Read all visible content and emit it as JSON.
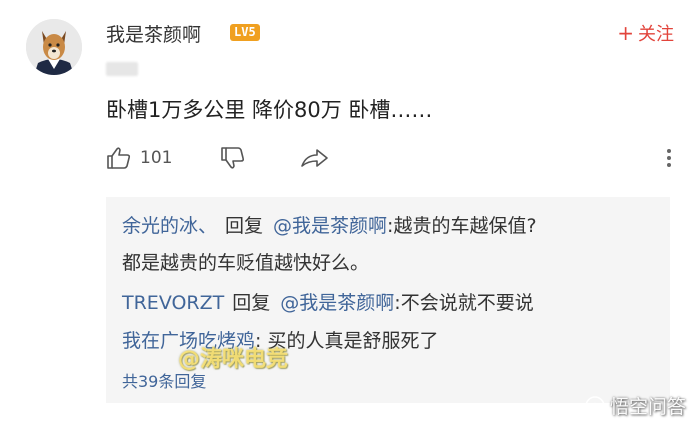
{
  "comment": {
    "username": "我是茶颜啊",
    "level": "LV5",
    "follow_label": "关注",
    "follow_prefix": "+",
    "text": "卧槽1万多公里 降价80万 卧槽……",
    "like_count": "101",
    "icons": [
      "avatar-dog",
      "thumbs-up-icon",
      "thumbs-down-icon",
      "share-icon",
      "more-vertical-icon"
    ]
  },
  "replies": {
    "items": [
      {
        "name": "余光的冰、",
        "action": "回复",
        "target": "@我是茶颜啊",
        "text": ":越贵的车越保值?",
        "continuation": "都是越贵的车贬值越快好么。"
      },
      {
        "name": "TREVORZT",
        "action": "回复",
        "target": "@我是茶颜啊",
        "text": ":不会说就不要说"
      },
      {
        "name": "我在广场吃烤鸡",
        "text": ": 买的人真是舒服死了"
      }
    ],
    "total_label": "共39条回复"
  },
  "watermarks": {
    "left": "@涛咪电竞",
    "right": "悟空问答"
  },
  "colors": {
    "accent_red": "#e2443b",
    "link_blue": "#406599",
    "badge_orange": "#f0a020",
    "reply_bg": "#f5f5f5"
  }
}
